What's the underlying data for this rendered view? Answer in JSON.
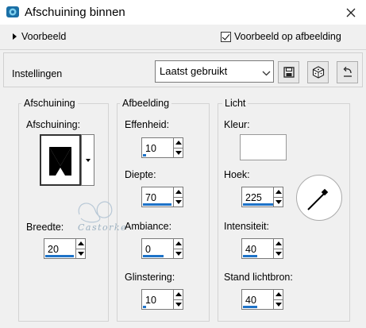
{
  "window": {
    "title": "Afschuining binnen"
  },
  "top": {
    "preview_toggle": "Voorbeeld",
    "preview_on_image": "Voorbeeld op afbeelding"
  },
  "settings": {
    "label": "Instellingen",
    "preset_value": "Laatst gebruikt"
  },
  "bevel_group": {
    "title": "Afschuining",
    "bevel_label": "Afschuining:",
    "width_label": "Breedte:",
    "width_value": "20"
  },
  "image_group": {
    "title": "Afbeelding",
    "smoothness_label": "Effenheid:",
    "smoothness_value": "10",
    "depth_label": "Diepte:",
    "depth_value": "70",
    "ambience_label": "Ambiance:",
    "ambience_value": "0",
    "shininess_label": "Glinstering:",
    "shininess_value": "10"
  },
  "light_group": {
    "title": "Licht",
    "color_label": "Kleur:",
    "color": "#ffffff",
    "angle_label": "Hoek:",
    "angle_value": "225",
    "intensity_label": "Intensiteit:",
    "intensity_value": "40",
    "elevation_label": "Stand lichtbron:",
    "elevation_value": "40"
  },
  "watermark": {
    "text": "Castorke"
  },
  "colors": {
    "accent": "#1e73c8",
    "background": "#f0f0f0"
  }
}
